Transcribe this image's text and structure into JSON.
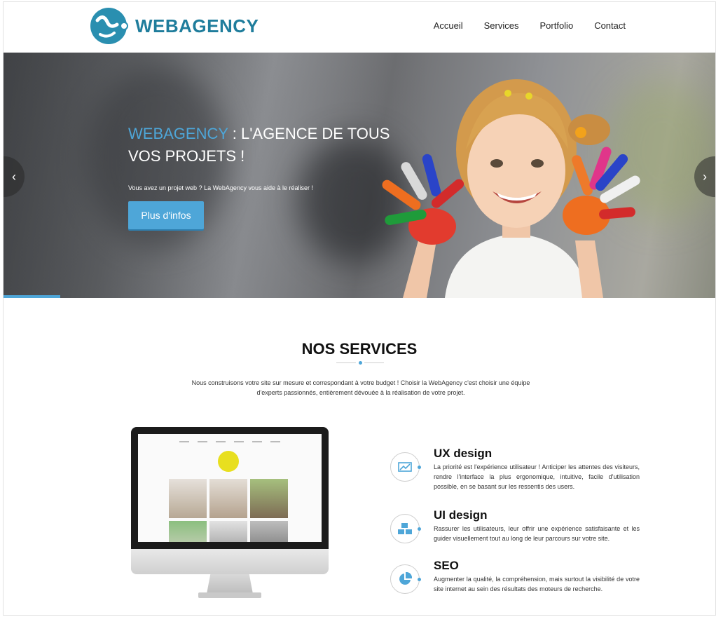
{
  "header": {
    "brand": "WEBAGENCY",
    "logo_icon": "webagency-logo-icon",
    "nav": [
      {
        "label": "Accueil"
      },
      {
        "label": "Services"
      },
      {
        "label": "Portfolio"
      },
      {
        "label": "Contact"
      }
    ]
  },
  "hero": {
    "title_brand": "WEBAGENCY",
    "title_rest": " : L'AGENCE DE TOUS VOS PROJETS !",
    "subtitle": "Vous avez un projet web ? La WebAgency vous aide à le réaliser !",
    "button_label": "Plus d'infos",
    "prev_icon": "‹",
    "next_icon": "›",
    "slide_progress": 0.08,
    "accent_color": "#4ea6d8"
  },
  "services": {
    "title": "NOS SERVICES",
    "intro": "Nous construisons votre site sur mesure et correspondant à votre budget ! Choisir la WebAgency c'est choisir une équipe d'experts passionnés, entièrement dévouée à la réalisation de votre projet.",
    "apple_logo": "",
    "items": [
      {
        "name": "UX design",
        "icon": "chart-trend-icon",
        "description": "La priorité est l'expérience utilisateur ! Anticiper les attentes des visiteurs, rendre l'interface la plus ergonomique, intuitive, facile d'utilisation possible, en se basant sur les ressentis des users."
      },
      {
        "name": "UI design",
        "icon": "cubes-icon",
        "description": "Rassurer les utilisateurs, leur offrir une expérience satisfaisante et les guider visuellement tout au long de leur parcours sur votre site."
      },
      {
        "name": "SEO",
        "icon": "pie-chart-icon",
        "description": "Augmenter la qualité, la compréhension, mais surtout la visibilité de votre site internet au sein des résultats des moteurs de recherche."
      }
    ]
  }
}
